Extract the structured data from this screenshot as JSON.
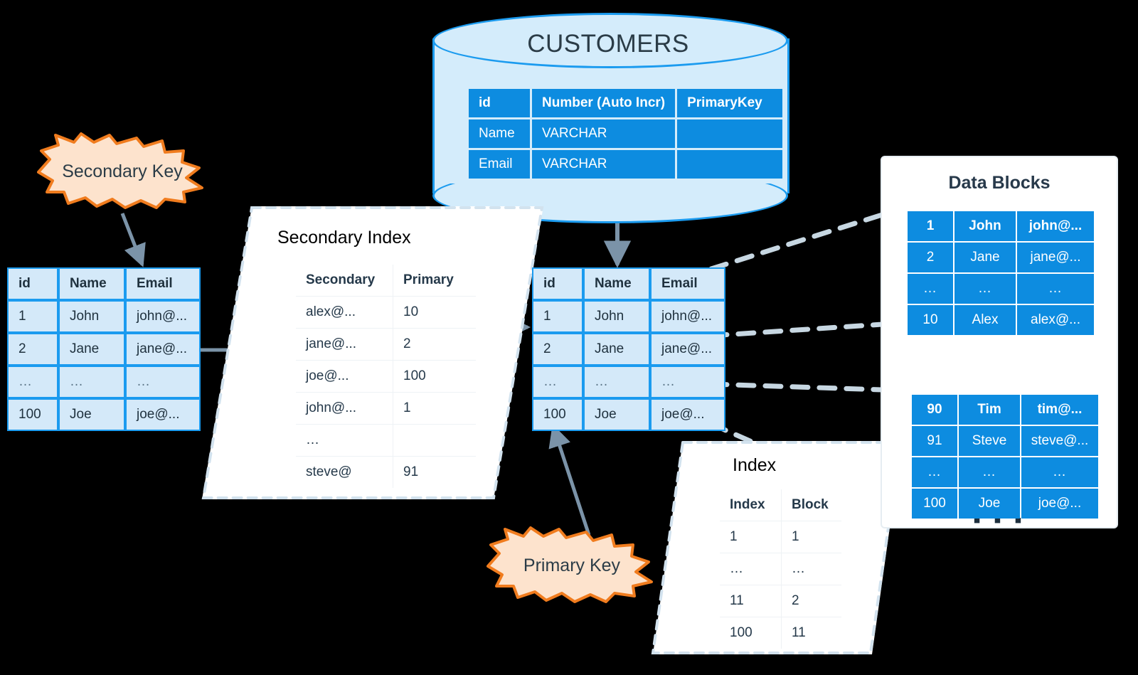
{
  "customers": {
    "title": "CUSTOMERS",
    "rows": [
      [
        "id",
        "Number (Auto Incr)",
        "PrimaryKey"
      ],
      [
        "Name",
        "VARCHAR",
        ""
      ],
      [
        "Email",
        "VARCHAR",
        ""
      ]
    ]
  },
  "left_table": {
    "headers": [
      "id",
      "Name",
      "Email"
    ],
    "rows": [
      [
        "1",
        "John",
        "john@..."
      ],
      [
        "2",
        "Jane",
        "jane@..."
      ],
      [
        "…",
        "…",
        "…"
      ],
      [
        "100",
        "Joe",
        "joe@..."
      ]
    ]
  },
  "secondary_index": {
    "title": "Secondary Index",
    "headers": [
      "Secondary",
      "Primary"
    ],
    "rows": [
      [
        "alex@...",
        "10"
      ],
      [
        "jane@...",
        "2"
      ],
      [
        "joe@...",
        "100"
      ],
      [
        "john@...",
        "1"
      ],
      [
        "…",
        ""
      ],
      [
        "steve@",
        "91"
      ]
    ]
  },
  "middle_table": {
    "headers": [
      "id",
      "Name",
      "Email"
    ],
    "rows": [
      [
        "1",
        "John",
        "john@..."
      ],
      [
        "2",
        "Jane",
        "jane@..."
      ],
      [
        "…",
        "…",
        "…"
      ],
      [
        "100",
        "Joe",
        "joe@..."
      ]
    ]
  },
  "index_panel": {
    "title": "Index",
    "headers": [
      "Index",
      "Block"
    ],
    "rows": [
      [
        "1",
        "1"
      ],
      [
        "…",
        "…"
      ],
      [
        "11",
        "2"
      ],
      [
        "100",
        "11"
      ]
    ]
  },
  "data_blocks": {
    "title": "Data Blocks",
    "ellipsis": "▪ ▪ ▪",
    "block1": [
      [
        "1",
        "John",
        "john@..."
      ],
      [
        "2",
        "Jane",
        "jane@..."
      ],
      [
        "…",
        "…",
        "…"
      ],
      [
        "10",
        "Alex",
        "alex@..."
      ]
    ],
    "block2": [
      [
        "90",
        "Tim",
        "tim@..."
      ],
      [
        "91",
        "Steve",
        "steve@..."
      ],
      [
        "…",
        "…",
        "…"
      ],
      [
        "100",
        "Joe",
        "joe@..."
      ]
    ]
  },
  "callouts": {
    "secondary_key": "Secondary Key",
    "primary_key": "Primary Key"
  },
  "colors": {
    "brand_blue": "#0d8ce0",
    "light_blue_fill": "#d4e9f9",
    "blue_border": "#1b9bef",
    "callout_fill": "#fde3cd",
    "callout_border": "#f07c1e",
    "arrow_gray": "#7b93a8",
    "dash_gray": "#c7d7e2",
    "text_dark": "#27394a",
    "background": "#000000"
  }
}
